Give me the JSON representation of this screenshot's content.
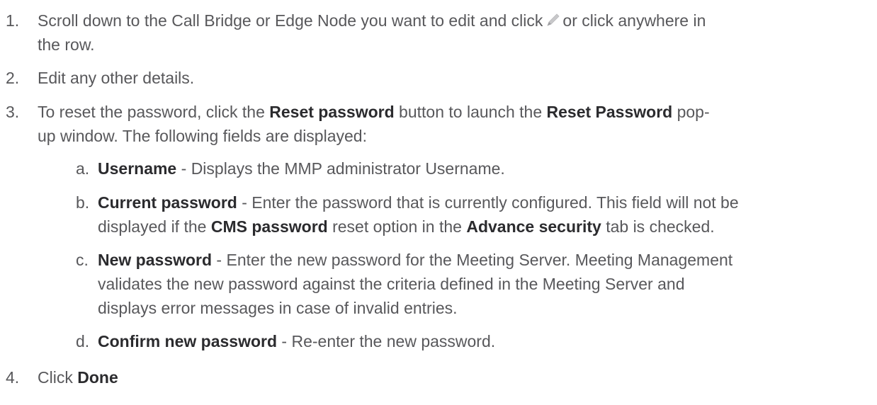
{
  "steps": [
    {
      "number": "1.",
      "line1_pre": "Scroll down to the Call Bridge or Edge Node you want to edit and click",
      "edit_icon": "pencil-icon",
      "line1_post": "or click anywhere in",
      "line2": "the row."
    },
    {
      "number": "2.",
      "text": "Edit any other details."
    },
    {
      "number": "3.",
      "t1": "To reset the password, click the ",
      "b1": "Reset password",
      "t2": " button to launch the ",
      "b2": "Reset Password",
      "t3": " pop-",
      "line2": "up window. The following fields are displayed:",
      "substeps": [
        {
          "letter": "a.",
          "term": "Username",
          "sep": " - ",
          "text": "Displays the MMP administrator Username."
        },
        {
          "letter": "b.",
          "term": "Current password",
          "sep": " - ",
          "text": "Enter the password that is currently configured. This field will not be",
          "line2_pre": "displayed if the ",
          "b1": "CMS password",
          "line2_mid": " reset option in the ",
          "b2": "Advance security",
          "line2_post": " tab is checked."
        },
        {
          "letter": "c.",
          "term": "New password",
          "sep": " - ",
          "text": "Enter the new password for the Meeting Server. Meeting Management",
          "line2": "validates the new password against the criteria defined in the Meeting Server and",
          "line3": "displays error messages in case of invalid entries."
        },
        {
          "letter": "d.",
          "term": "Confirm new password",
          "sep": " - ",
          "text": "Re-enter the new password."
        }
      ]
    },
    {
      "number": "4.",
      "text": "Click ",
      "bold": "Done"
    }
  ]
}
